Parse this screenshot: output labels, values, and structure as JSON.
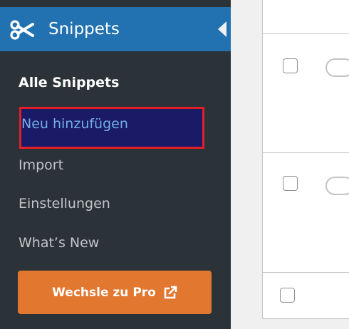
{
  "sidebar": {
    "menu_title": "Snippets",
    "items": [
      {
        "label": "Alle Snippets"
      },
      {
        "label": "Neu hinzufügen"
      },
      {
        "label": "Import"
      },
      {
        "label": "Einstellungen"
      },
      {
        "label": "What’s New"
      }
    ],
    "pro_button": {
      "label": "Wechsle zu Pro",
      "icon": "external-link-icon"
    }
  },
  "colors": {
    "sidebar_bg": "#2c3338",
    "menu_active_bg": "#2271b1",
    "highlight_border": "#e21f26",
    "pro_button_bg": "#e27730"
  },
  "table": {
    "rows": [
      {
        "checked": false,
        "active": false
      },
      {
        "checked": false,
        "active": false
      },
      {
        "checked": false
      }
    ]
  }
}
